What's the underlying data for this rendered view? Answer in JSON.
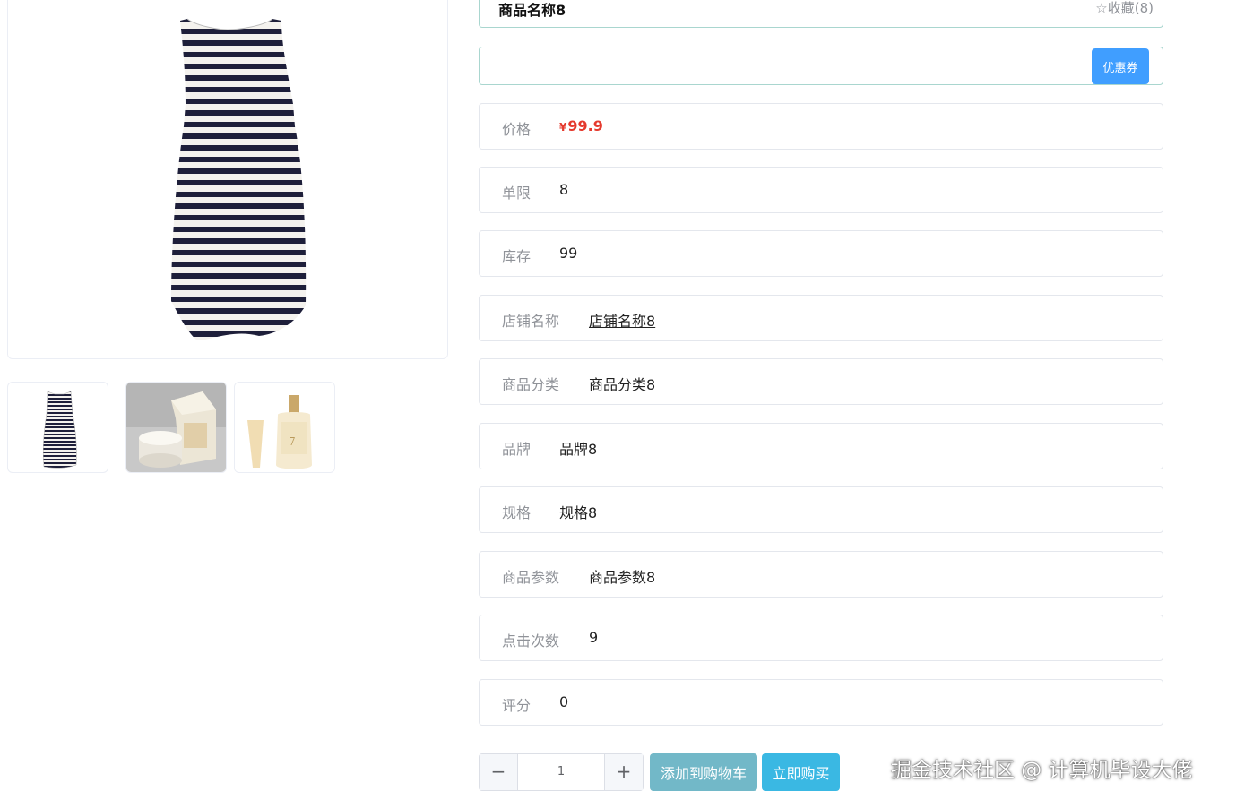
{
  "product": {
    "title": "商品名称8",
    "favorite_label": "☆收藏(8)"
  },
  "coupon": {
    "button_label": "优惠券"
  },
  "details": {
    "price": {
      "label": "价格",
      "currency": "¥",
      "value": "99.9"
    },
    "limit": {
      "label": "单限",
      "value": "8"
    },
    "stock": {
      "label": "库存",
      "value": "99"
    },
    "shop": {
      "label": "店铺名称",
      "value": "店铺名称8"
    },
    "category": {
      "label": "商品分类",
      "value": "商品分类8"
    },
    "brand": {
      "label": "品牌",
      "value": "品牌8"
    },
    "spec": {
      "label": "规格",
      "value": "规格8"
    },
    "params": {
      "label": "商品参数",
      "value": "商品参数8"
    },
    "clicks": {
      "label": "点击次数",
      "value": "9"
    },
    "rating": {
      "label": "评分",
      "value": "0"
    }
  },
  "actions": {
    "quantity": "1",
    "minus_symbol": "−",
    "plus_symbol": "+",
    "add_to_cart_label": "添加到购物车",
    "buy_now_label": "立即购买"
  },
  "gallery": {
    "main_image": "striped-sleeveless-dress",
    "thumbnails": [
      "striped-dress-thumb",
      "cosmetic-jar-box-thumb",
      "cosmetic-bottle-thumb"
    ]
  },
  "watermark": "掘金技术社区 @ 计算机毕设大佬",
  "colors": {
    "accent_blue": "#409eff",
    "price_red": "#e53a2e",
    "cart_button": "#72b8c8",
    "buy_button": "#3ab8e3",
    "stripe_navy": "#1e1f3a"
  }
}
